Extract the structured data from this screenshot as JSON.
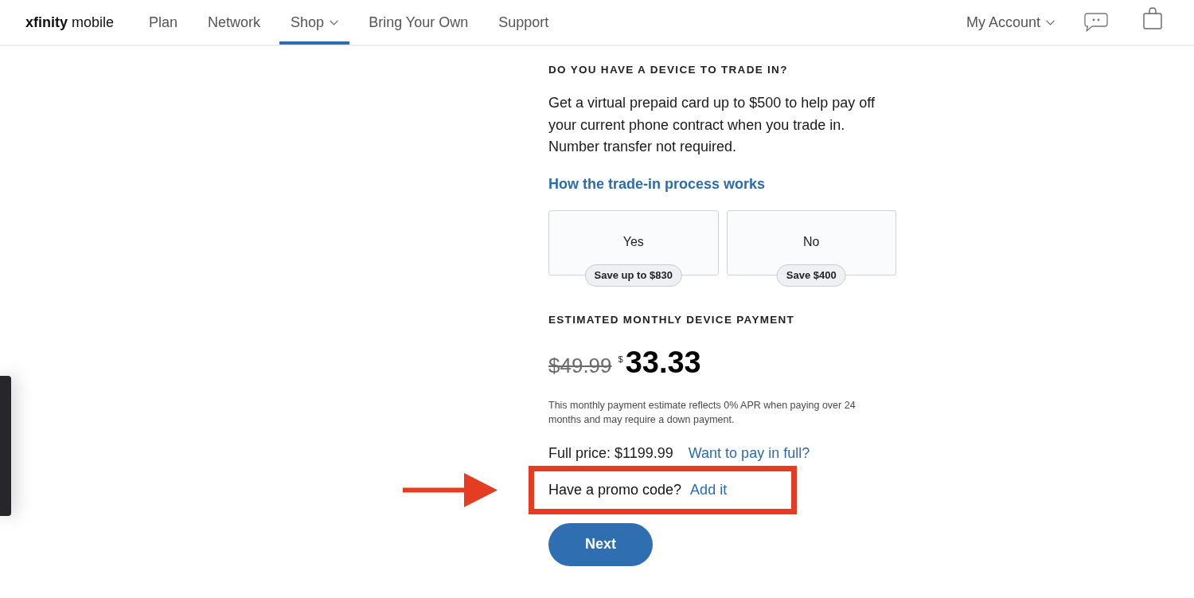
{
  "header": {
    "brand": "**xfinity** mobile",
    "nav": [
      {
        "label": "Plan",
        "kind": "link",
        "selected": false
      },
      {
        "label": "Network",
        "kind": "link",
        "selected": false
      },
      {
        "label": "Shop",
        "kind": "menu",
        "selected": true
      },
      {
        "label": "Bring Your Own",
        "kind": "link",
        "selected": false
      },
      {
        "label": "Support",
        "kind": "link",
        "selected": false
      }
    ],
    "account": {
      "label": "My Account",
      "kind": "menu"
    }
  },
  "trade_in": {
    "heading": "DO YOU HAVE A DEVICE TO TRADE IN?",
    "description": "Get a virtual prepaid card up to $500 to help pay off your current phone contract when you trade in. Number transfer not required.",
    "link": "How the trade-in process works",
    "options": [
      {
        "label": "Yes",
        "badge": "Save up to $830",
        "selected": false
      },
      {
        "label": "No",
        "badge": "Save $400",
        "selected": false
      }
    ]
  },
  "payment": {
    "heading": "ESTIMATED MONTHLY DEVICE PAYMENT",
    "original_price": "$49.99",
    "currency": "$",
    "price": "33.33",
    "disclaimer": "This monthly payment estimate reflects 0% APR when paying over 24 months and may require a down payment.",
    "full_price": "Full price: $1199.99",
    "full_price_link": "Want to pay in full?"
  },
  "promo": {
    "label": "Have a promo code?",
    "link": "Add it",
    "highlighted": true
  },
  "next_button": "Next"
}
